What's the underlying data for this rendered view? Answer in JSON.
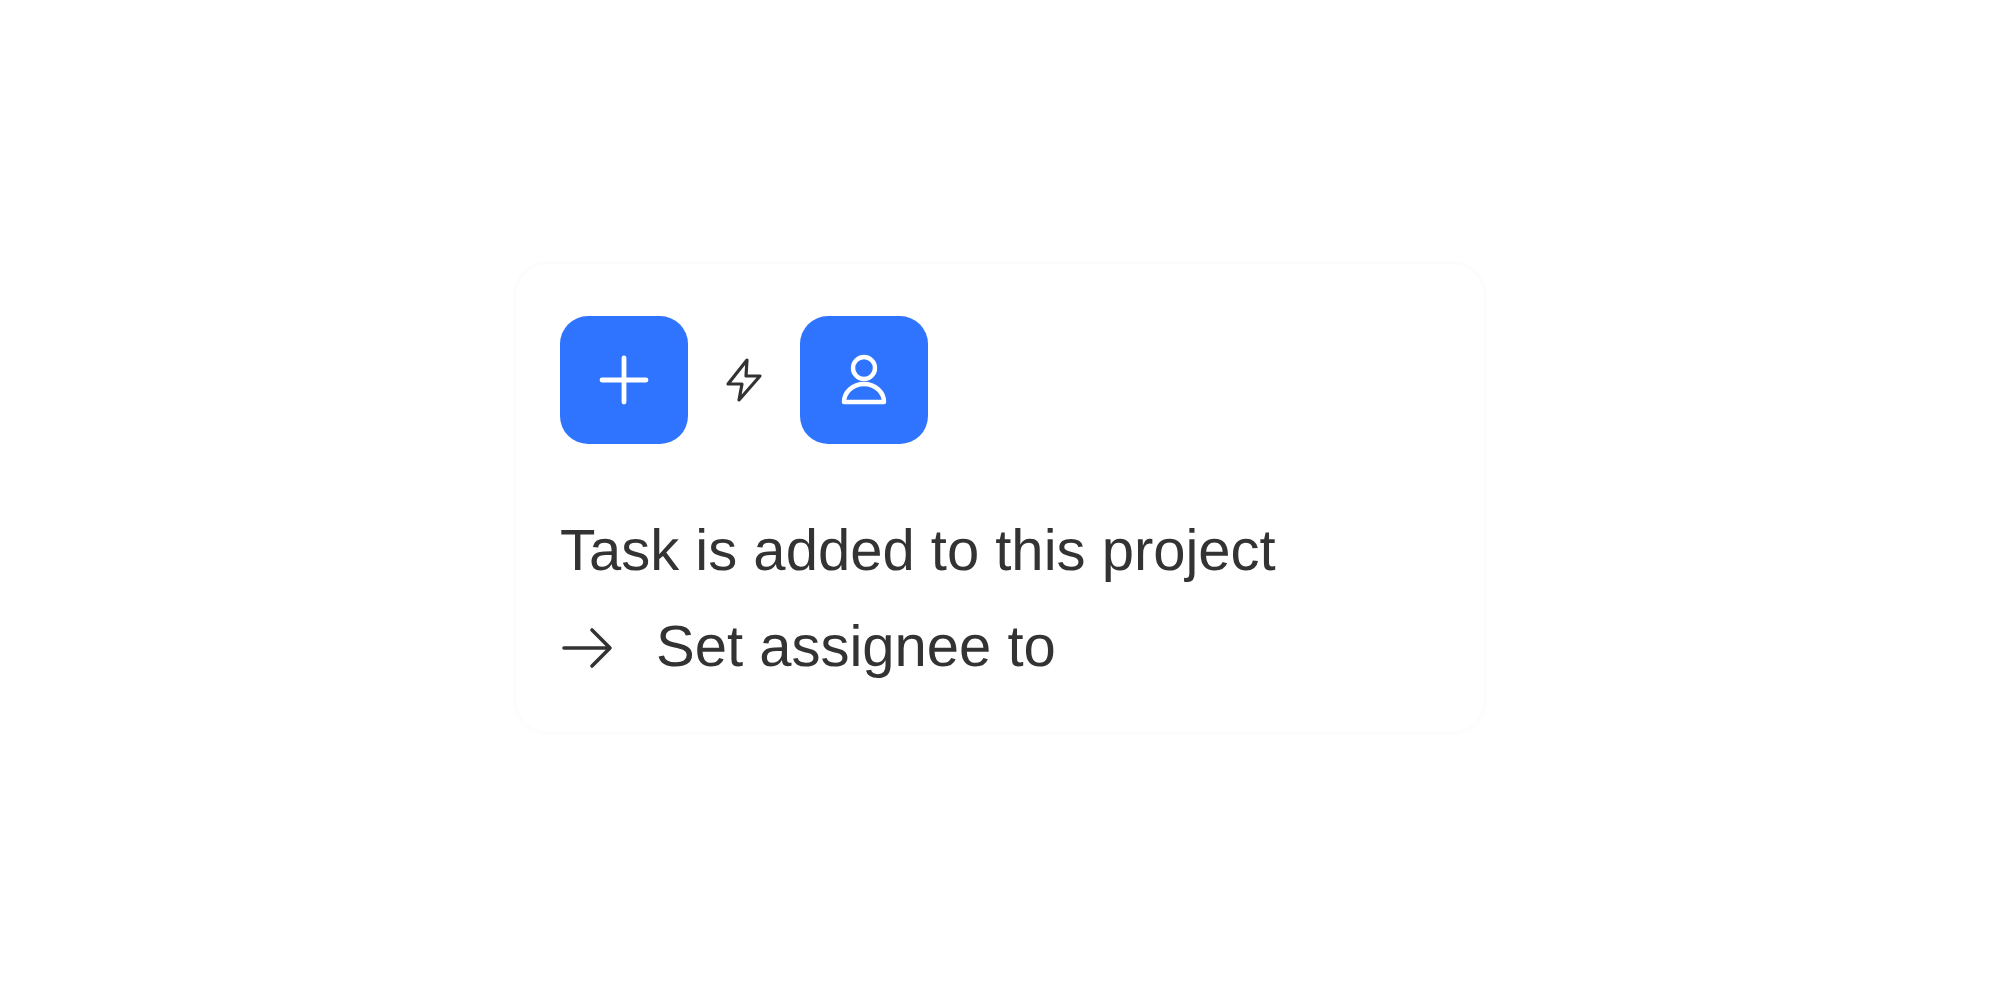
{
  "rule": {
    "trigger": {
      "kind": "add"
    },
    "action": {
      "kind": "person"
    },
    "trigger_text": "Task is added to this project",
    "action_text": "Set assignee to"
  }
}
